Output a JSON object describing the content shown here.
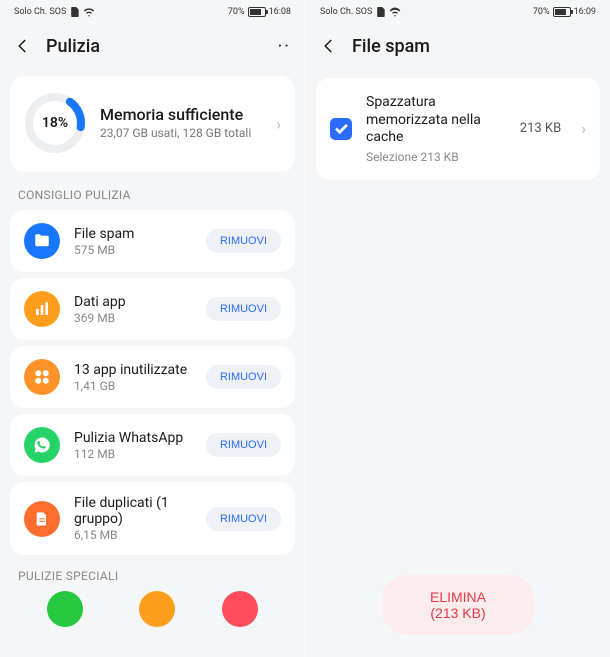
{
  "left": {
    "status": {
      "carrier": "Solo Ch. SOS",
      "battery_pct": "70%",
      "time": "16:08"
    },
    "header": {
      "title": "Pulizia",
      "menu": "··"
    },
    "memory": {
      "pct": "18%",
      "title": "Memoria sufficiente",
      "sub": "23,07 GB usati, 128 GB totali"
    },
    "section1": "CONSIGLIO PULIZIA",
    "remove_label": "RIMUOVI",
    "items": [
      {
        "title": "File spam",
        "sub": "575 MB",
        "icon": "folder-icon",
        "color": "ic-blue"
      },
      {
        "title": "Dati app",
        "sub": "369 MB",
        "icon": "chart-icon",
        "color": "ic-orange"
      },
      {
        "title": "13 app inutilizzate",
        "sub": "1,41 GB",
        "icon": "apps-icon",
        "color": "ic-orange2"
      },
      {
        "title": "Pulizia WhatsApp",
        "sub": "112 MB",
        "icon": "whatsapp-icon",
        "color": "ic-green-wa"
      },
      {
        "title": "File duplicati (1 gruppo)",
        "sub": "6,15 MB",
        "icon": "document-icon",
        "color": "ic-orange3"
      }
    ],
    "section2": "PULIZIE SPECIALI"
  },
  "right": {
    "status": {
      "carrier": "Solo Ch. SOS",
      "battery_pct": "70%",
      "time": "16:09"
    },
    "header": {
      "title": "File spam"
    },
    "entry": {
      "title": "Spazzatura memorizzata nella cache",
      "sub": "Selezione 213 KB",
      "size": "213 KB"
    },
    "delete_label": "ELIMINA (213 KB)"
  }
}
